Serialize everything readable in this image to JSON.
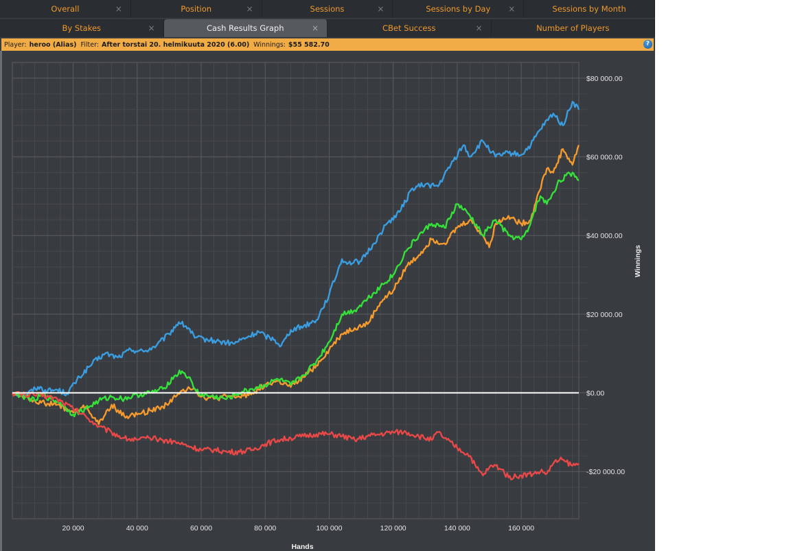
{
  "tabs_row1": [
    {
      "label": "Overall",
      "active": false
    },
    {
      "label": "Position",
      "active": false
    },
    {
      "label": "Sessions",
      "active": false
    },
    {
      "label": "Sessions by Day",
      "active": false
    },
    {
      "label": "Sessions by Month",
      "active": false
    }
  ],
  "tabs_row2": [
    {
      "label": "By Stakes",
      "active": false
    },
    {
      "label": "Cash Results Graph",
      "active": true
    },
    {
      "label": "CBet Success",
      "active": false
    },
    {
      "label": "Number of Players",
      "active": false
    }
  ],
  "close_glyph": "×",
  "infobar": {
    "player_label": "Player:",
    "player_value": "heroo (Alias)",
    "filter_label": "Filter:",
    "filter_value": "After torstai 20. helmikuuta 2020 (6.00)",
    "winnings_label": "Winnings:",
    "winnings_value": "$55 582.70",
    "help_icon": "?"
  },
  "chart_data": {
    "type": "line",
    "title": "",
    "xlabel": "Hands",
    "ylabel": "Winnings",
    "xlim": [
      1000,
      178000
    ],
    "ylim": [
      -32000,
      84000
    ],
    "x_ticks": [
      20000,
      40000,
      60000,
      80000,
      100000,
      120000,
      140000,
      160000
    ],
    "x_tick_labels": [
      "20 000",
      "40 000",
      "60 000",
      "80 000",
      "100 000",
      "120 000",
      "140 000",
      "160 000"
    ],
    "y_ticks": [
      -20000,
      0,
      20000,
      40000,
      60000,
      80000
    ],
    "y_tick_labels": [
      "-$20 000.00",
      "$0.00",
      "$20 000.00",
      "$40 000.00",
      "$60 000.00",
      "$80 000.00"
    ],
    "grid": true,
    "zero_line": true,
    "legend": "none",
    "series": [
      {
        "name": "blue",
        "color": "#3a9de0",
        "x": [
          1000,
          5000,
          9000,
          12000,
          15000,
          18000,
          22000,
          26000,
          30000,
          34000,
          38000,
          42000,
          46000,
          50000,
          53000,
          56000,
          58000,
          62000,
          66000,
          70000,
          74000,
          78000,
          80000,
          83000,
          85000,
          88000,
          92000,
          96000,
          100000,
          104000,
          106000,
          110000,
          114000,
          118000,
          122000,
          126000,
          130000,
          134000,
          138000,
          142000,
          144000,
          148000,
          152000,
          156000,
          160000,
          163000,
          166000,
          170000,
          173000,
          176000,
          178000
        ],
        "y": [
          0,
          -500,
          1500,
          500,
          800,
          -200,
          4000,
          7500,
          10000,
          9000,
          11000,
          10500,
          12000,
          15000,
          18000,
          16500,
          14000,
          13500,
          13000,
          12500,
          14000,
          15500,
          14500,
          13500,
          12000,
          16000,
          17000,
          18500,
          25000,
          34000,
          33000,
          33500,
          38000,
          43000,
          46000,
          52000,
          53000,
          52500,
          58000,
          63000,
          60000,
          64000,
          60000,
          61000,
          60500,
          63000,
          67000,
          71000,
          68000,
          74000,
          72000
        ]
      },
      {
        "name": "orange",
        "color": "#f49a2e",
        "x": [
          1000,
          5000,
          10000,
          15000,
          20000,
          24000,
          28000,
          32000,
          36000,
          40000,
          44000,
          48000,
          52000,
          56000,
          58000,
          60000,
          64000,
          68000,
          72000,
          76000,
          80000,
          84000,
          88000,
          92000,
          96000,
          100000,
          104000,
          108000,
          112000,
          116000,
          120000,
          124000,
          128000,
          132000,
          136000,
          140000,
          144000,
          148000,
          150000,
          152000,
          156000,
          160000,
          163000,
          165000,
          168000,
          170000,
          173000,
          176000,
          178000
        ],
        "y": [
          0,
          -1000,
          -2500,
          -3000,
          -5000,
          -3500,
          -8000,
          -3000,
          -6000,
          -5500,
          -4500,
          -3500,
          -1000,
          1500,
          1000,
          -1000,
          -1500,
          -1000,
          -1000,
          0,
          2000,
          3000,
          1500,
          4000,
          7000,
          11000,
          15000,
          16500,
          17500,
          23000,
          26000,
          32000,
          35000,
          39000,
          38000,
          42000,
          44000,
          40000,
          37000,
          43000,
          45000,
          43000,
          44000,
          50000,
          57000,
          56000,
          62000,
          58000,
          63000
        ]
      },
      {
        "name": "green",
        "color": "#36e03a",
        "x": [
          1000,
          5000,
          8000,
          10000,
          13000,
          16000,
          20000,
          24000,
          28000,
          32000,
          36000,
          40000,
          44000,
          48000,
          52000,
          54000,
          56000,
          58000,
          60000,
          64000,
          68000,
          72000,
          76000,
          80000,
          84000,
          88000,
          92000,
          96000,
          100000,
          104000,
          108000,
          112000,
          116000,
          120000,
          124000,
          128000,
          132000,
          136000,
          140000,
          144000,
          148000,
          150000,
          152000,
          156000,
          160000,
          162000,
          164000,
          166000,
          168000,
          172000,
          176000,
          178000
        ],
        "y": [
          0,
          -1000,
          -2000,
          -500,
          -1500,
          -2500,
          -5500,
          -4000,
          -2000,
          -1000,
          -1500,
          -500,
          0,
          1000,
          4500,
          5500,
          4000,
          1000,
          -500,
          -1000,
          -1500,
          0,
          1000,
          2000,
          3500,
          2000,
          4500,
          8000,
          13000,
          20000,
          21000,
          24000,
          27000,
          30000,
          36000,
          40000,
          43000,
          42000,
          48000,
          45000,
          40000,
          42000,
          44000,
          40000,
          39000,
          41000,
          46000,
          50000,
          48000,
          54000,
          56000,
          54000
        ]
      },
      {
        "name": "red",
        "color": "#e84848",
        "x": [
          1000,
          5000,
          10000,
          15000,
          20000,
          24000,
          28000,
          32000,
          36000,
          40000,
          44000,
          48000,
          52000,
          56000,
          60000,
          64000,
          68000,
          72000,
          76000,
          80000,
          84000,
          88000,
          92000,
          96000,
          100000,
          104000,
          108000,
          112000,
          116000,
          120000,
          124000,
          128000,
          132000,
          134000,
          136000,
          140000,
          144000,
          146000,
          148000,
          150000,
          152000,
          154000,
          156000,
          160000,
          164000,
          166000,
          168000,
          170000,
          172000,
          174000,
          176000,
          178000
        ],
        "y": [
          0,
          -500,
          -500,
          -1500,
          -4000,
          -6000,
          -8500,
          -10000,
          -11500,
          -12000,
          -11500,
          -12000,
          -12500,
          -13500,
          -14500,
          -14500,
          -15000,
          -15000,
          -14500,
          -13000,
          -12000,
          -11500,
          -11000,
          -10500,
          -10500,
          -11000,
          -12000,
          -11000,
          -10500,
          -10000,
          -10000,
          -11000,
          -12000,
          -10000,
          -11500,
          -14000,
          -16000,
          -19000,
          -21000,
          -19000,
          -18500,
          -19500,
          -21500,
          -21000,
          -20500,
          -20000,
          -20500,
          -18000,
          -17000,
          -17500,
          -18500,
          -18000
        ]
      }
    ]
  }
}
